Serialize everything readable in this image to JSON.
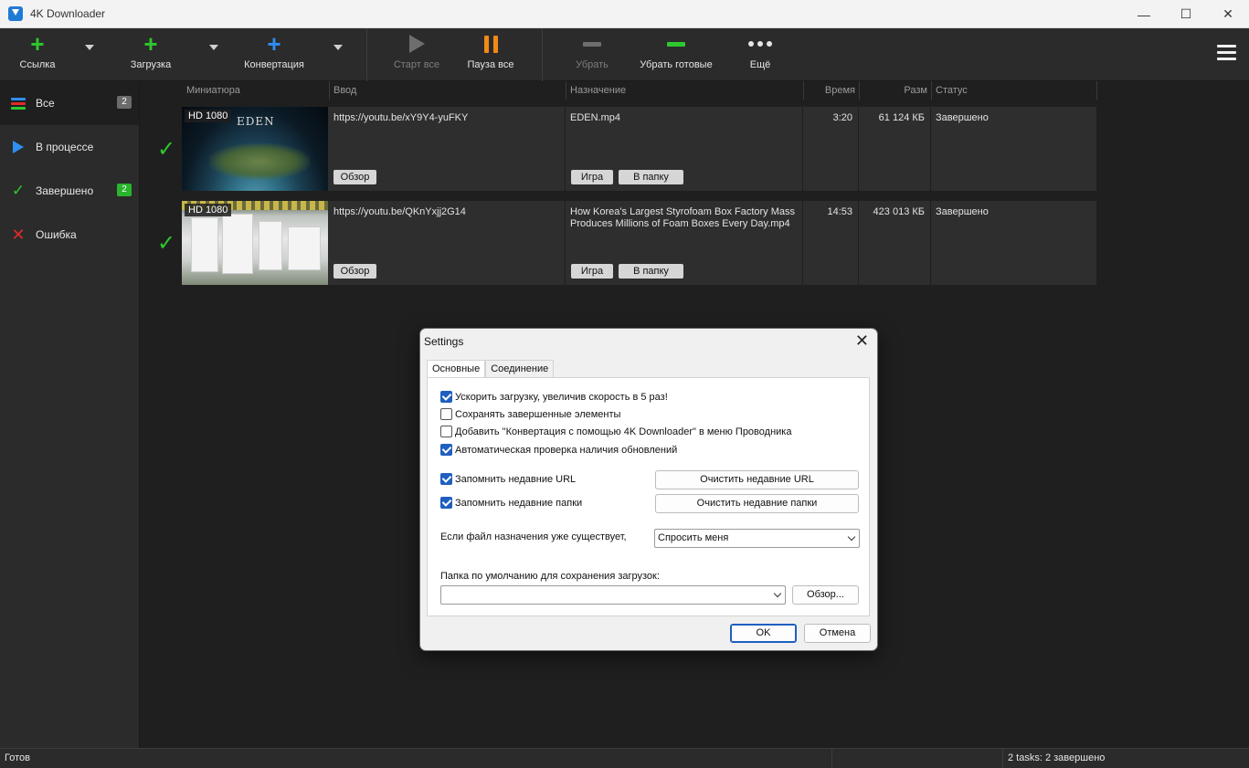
{
  "app": {
    "title": "4K Downloader"
  },
  "toolbar": {
    "link_label": "Ссылка",
    "download_label": "Загрузка",
    "convert_label": "Конвертация",
    "start_all_label": "Старт все",
    "pause_all_label": "Пауза все",
    "remove_label": "Убрать",
    "remove_done_label": "Убрать готовые",
    "more_label": "Ещё"
  },
  "sidebar": {
    "items": [
      {
        "label": "Все",
        "count": "2"
      },
      {
        "label": "В процессе",
        "count": ""
      },
      {
        "label": "Завершено",
        "count": "2"
      },
      {
        "label": "Ошибка",
        "count": ""
      }
    ]
  },
  "columns": {
    "thumbnail": "Миниатюра",
    "input": "Ввод",
    "destination": "Назначение",
    "time": "Время",
    "size": "Разм",
    "status": "Статус"
  },
  "rows": [
    {
      "quality": "HD 1080",
      "thumb_text": "EDEN",
      "url": "https://youtu.be/xY9Y4-yuFKY",
      "browse_label": "Обзор",
      "file": "EDEN.mp4",
      "play_label": "Игра",
      "folder_label": "В папку",
      "time": "3:20",
      "size": "61 124 КБ",
      "status": "Завершено"
    },
    {
      "quality": "HD 1080",
      "url": "https://youtu.be/QKnYxjj2G14",
      "browse_label": "Обзор",
      "file": "How Korea's Largest Styrofoam Box Factory Mass Produces Millions of Foam Boxes Every Day.mp4",
      "play_label": "Игра",
      "folder_label": "В папку",
      "time": "14:53",
      "size": "423 013 КБ",
      "status": "Завершено"
    }
  ],
  "statusbar": {
    "left": "Готов",
    "right": "2 tasks: 2 завершено"
  },
  "dialog": {
    "title": "Settings",
    "tabs": [
      "Основные",
      "Соединение"
    ],
    "options": [
      {
        "label": "Ускорить загрузку, увеличив скорость в 5 раз!",
        "checked": true
      },
      {
        "label": "Сохранять завершенные элементы",
        "checked": false
      },
      {
        "label": "Добавить \"Конвертация с помощью 4K Downloader\" в меню Проводника",
        "checked": false
      },
      {
        "label": "Автоматическая проверка наличия обновлений",
        "checked": true
      },
      {
        "label": "Запомнить недавние URL",
        "checked": true
      },
      {
        "label": "Запомнить недавние папки",
        "checked": true
      }
    ],
    "clear_urls_label": "Очистить недавние URL",
    "clear_folders_label": "Очистить недавние папки",
    "exists_label": "Если файл назначения уже существует,",
    "exists_value": "Спросить меня",
    "default_folder_label": "Папка по умолчанию для сохранения загрузок:",
    "default_folder_value": "",
    "browse_label": "Обзор...",
    "ok_label": "OK",
    "cancel_label": "Отмена"
  }
}
